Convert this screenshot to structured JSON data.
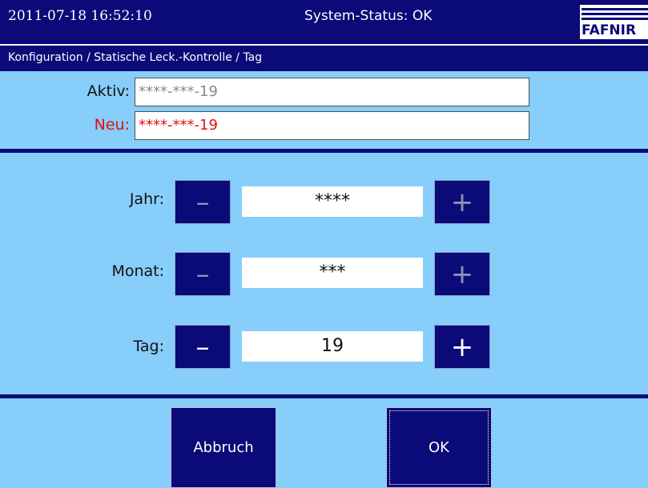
{
  "header": {
    "datetime": "2011-07-18  16:52:10",
    "status": "System-Status: OK",
    "logo_text": "FAFNIR"
  },
  "breadcrumb": "Konfiguration / Statische Leck.-Kontrolle / Tag",
  "current": {
    "label": "Aktiv:",
    "value": "****-***-19"
  },
  "new": {
    "label": "Neu:",
    "value": "****-***-19"
  },
  "steppers": [
    {
      "label": "Jahr:",
      "value": "****",
      "minus": "–",
      "plus": "+",
      "enabled": false
    },
    {
      "label": "Monat:",
      "value": "***",
      "minus": "–",
      "plus": "+",
      "enabled": false
    },
    {
      "label": "Tag:",
      "value": "19",
      "minus": "–",
      "plus": "+",
      "enabled": true
    }
  ],
  "buttons": {
    "cancel": "Abbruch",
    "ok": "OK"
  },
  "colors": {
    "background": "#87cefa",
    "bar": "#0a0a78",
    "new_text": "#e01010",
    "disabled_glyph": "#8b93b8"
  }
}
